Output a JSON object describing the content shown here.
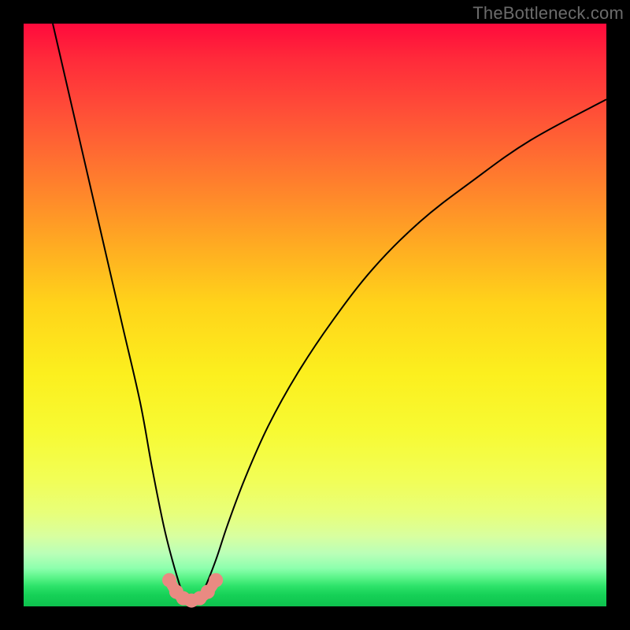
{
  "watermark": {
    "text": "TheBottleneck.com"
  },
  "chart_data": {
    "type": "line",
    "title": "",
    "xlabel": "",
    "ylabel": "",
    "xlim": [
      0,
      100
    ],
    "ylim": [
      0,
      100
    ],
    "grid": false,
    "legend": false,
    "background_gradient": {
      "direction": "vertical",
      "stops": [
        {
          "pos": 0,
          "color": "#ff0a3c"
        },
        {
          "pos": 50,
          "color": "#ffd31a"
        },
        {
          "pos": 80,
          "color": "#f2fe55"
        },
        {
          "pos": 92,
          "color": "#8cffad"
        },
        {
          "pos": 100,
          "color": "#0ec24e"
        }
      ]
    },
    "series": [
      {
        "name": "bottleneck-curve",
        "color": "#000000",
        "x": [
          5,
          8,
          11,
          14,
          17,
          20,
          22,
          24,
          25.5,
          27,
          28,
          29.5,
          31,
          33,
          35,
          38,
          42,
          47,
          53,
          60,
          68,
          77,
          87,
          100
        ],
        "y": [
          100,
          87,
          74,
          61,
          48,
          35,
          24,
          14,
          8,
          3,
          0.5,
          0.5,
          3,
          8,
          14,
          22,
          31,
          40,
          49,
          58,
          66,
          73,
          80,
          87
        ]
      }
    ],
    "markers": [
      {
        "name": "min-marker",
        "x": 25.0,
        "y": 4.5,
        "r": 1.0,
        "color": "#e98a82"
      },
      {
        "name": "min-marker",
        "x": 26.2,
        "y": 2.5,
        "r": 1.0,
        "color": "#e98a82"
      },
      {
        "name": "min-marker",
        "x": 27.4,
        "y": 1.4,
        "r": 1.0,
        "color": "#e98a82"
      },
      {
        "name": "min-marker",
        "x": 28.8,
        "y": 1.0,
        "r": 1.0,
        "color": "#e98a82"
      },
      {
        "name": "min-marker",
        "x": 30.2,
        "y": 1.4,
        "r": 1.0,
        "color": "#e98a82"
      },
      {
        "name": "min-marker",
        "x": 31.6,
        "y": 2.5,
        "r": 1.0,
        "color": "#e98a82"
      },
      {
        "name": "min-marker",
        "x": 33.0,
        "y": 4.5,
        "r": 1.0,
        "color": "#e98a82"
      }
    ],
    "min_band": {
      "color": "#e98a82",
      "stroke_width": 8,
      "x": [
        25.0,
        26.2,
        27.4,
        28.8,
        30.2,
        31.6,
        33.0
      ],
      "y": [
        4.5,
        2.5,
        1.4,
        1.0,
        1.4,
        2.5,
        4.5
      ]
    }
  }
}
